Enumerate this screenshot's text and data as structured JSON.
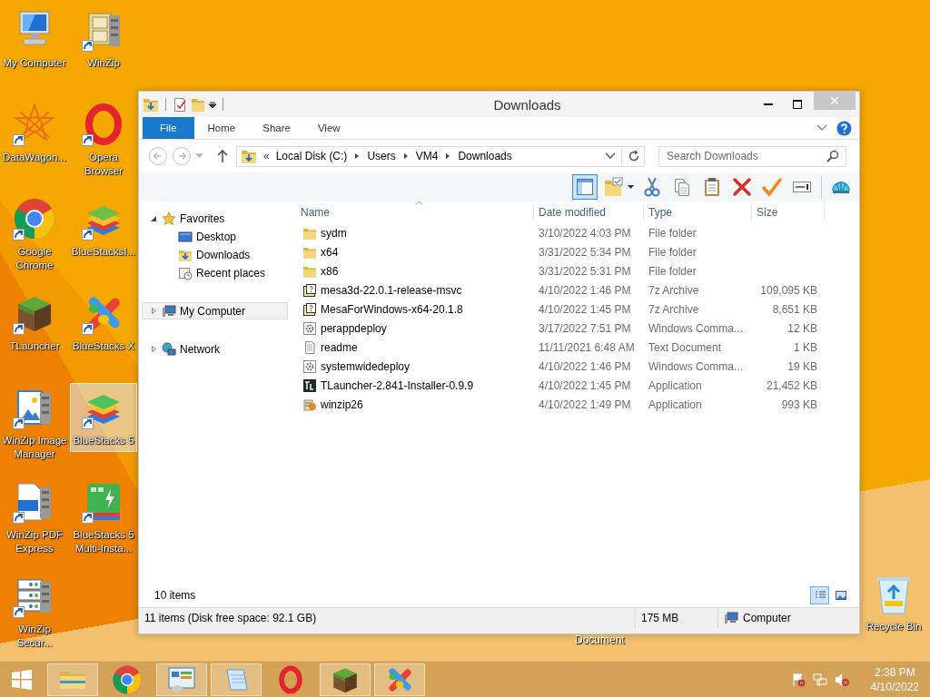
{
  "desktop": {
    "icons": [
      {
        "label": "My Computer",
        "shortcut": false,
        "selected": false
      },
      {
        "label": "WinZip",
        "shortcut": true,
        "selected": false
      },
      {
        "label": "DataWagon...",
        "shortcut": true,
        "selected": false
      },
      {
        "label": "Opera Browser",
        "shortcut": true,
        "selected": false
      },
      {
        "label": "Google Chrome",
        "shortcut": true,
        "selected": false
      },
      {
        "label": "BlueStacksI...",
        "shortcut": true,
        "selected": false
      },
      {
        "label": "TLauncher",
        "shortcut": true,
        "selected": false
      },
      {
        "label": "BlueStacks X",
        "shortcut": true,
        "selected": false
      },
      {
        "label": "WinZip Image Manager",
        "shortcut": true,
        "selected": false
      },
      {
        "label": "BlueStacks 5",
        "shortcut": true,
        "selected": true
      },
      {
        "label": "WinZip PDF Express",
        "shortcut": true,
        "selected": false
      },
      {
        "label": "BlueStacks 5 Multi-Insta...",
        "shortcut": true,
        "selected": false
      },
      {
        "label": "WinZip Secur...",
        "shortcut": true,
        "selected": false
      }
    ],
    "partial_icon": {
      "label": "Document"
    },
    "recycle_bin": {
      "label": "Recycle Bin"
    }
  },
  "window": {
    "title": "Downloads",
    "ribbon_tabs": [
      {
        "label": "File",
        "kind": "file",
        "selected": false
      },
      {
        "label": "Home",
        "kind": "tab",
        "selected": false
      },
      {
        "label": "Share",
        "kind": "tab",
        "selected": false
      },
      {
        "label": "View",
        "kind": "tab",
        "selected": false
      }
    ],
    "navigation": {
      "back_enabled": false,
      "forward_enabled": false
    },
    "address_bar": {
      "overflow": "«",
      "crumbs": [
        "Local Disk (C:)",
        "Users",
        "VM4",
        "Downloads"
      ]
    },
    "search": {
      "placeholder": "Search Downloads"
    },
    "toolbar": [
      {
        "kind": "pane",
        "selected": true
      },
      {
        "kind": "properties",
        "selected": false
      },
      {
        "kind": "cut",
        "selected": false
      },
      {
        "kind": "copy",
        "selected": false
      },
      {
        "kind": "paste",
        "selected": false
      },
      {
        "kind": "delete",
        "selected": false
      },
      {
        "kind": "check",
        "selected": false
      },
      {
        "kind": "rename",
        "selected": false
      },
      {
        "kind": "globe",
        "selected": false
      }
    ],
    "nav_pane": [
      {
        "label": "Favorites",
        "kind": "favorites",
        "expanded": true,
        "selected": false,
        "children": [
          {
            "label": "Desktop",
            "kind": "desktop",
            "selected": false
          },
          {
            "label": "Downloads",
            "kind": "downloads",
            "selected": false
          },
          {
            "label": "Recent places",
            "kind": "recent",
            "selected": false
          }
        ]
      },
      {
        "label": "My Computer",
        "kind": "computer",
        "expanded": false,
        "selected": true
      },
      {
        "label": "Network",
        "kind": "network",
        "expanded": false,
        "selected": false
      }
    ],
    "columns": [
      {
        "label": "Name",
        "sorted": true
      },
      {
        "label": "Date modified",
        "sorted": false
      },
      {
        "label": "Type",
        "sorted": false
      },
      {
        "label": "Size",
        "sorted": false
      }
    ],
    "files": [
      {
        "name": "sydm",
        "date": "3/10/2022 4:03 PM",
        "type": "File folder",
        "kind": "folder"
      },
      {
        "name": "x64",
        "date": "3/31/2022 5:34 PM",
        "type": "File folder",
        "kind": "folder"
      },
      {
        "name": "x86",
        "date": "3/31/2022 5:31 PM",
        "type": "File folder",
        "kind": "folder"
      },
      {
        "name": "mesa3d-22.0.1-release-msvc",
        "date": "4/10/2022 1:46 PM",
        "type": "7z Archive",
        "size": "109,095 KB",
        "kind": "archive"
      },
      {
        "name": "MesaForWindows-x64-20.1.8",
        "date": "4/10/2022 1:45 PM",
        "type": "7z Archive",
        "size": "8,651 KB",
        "kind": "archive"
      },
      {
        "name": "perappdeploy",
        "date": "3/17/2022 7:51 PM",
        "type": "Windows Comma...",
        "size": "12 KB",
        "kind": "script"
      },
      {
        "name": "readme",
        "date": "11/11/2021 6:48 AM",
        "type": "Text Document",
        "size": "1 KB",
        "kind": "text"
      },
      {
        "name": "systemwidedeploy",
        "date": "4/10/2022 1:46 PM",
        "type": "Windows Comma...",
        "size": "19 KB",
        "kind": "script"
      },
      {
        "name": "TLauncher-2.841-Installer-0.9.9",
        "date": "4/10/2022 1:45 PM",
        "type": "Application",
        "size": "21,452 KB",
        "kind": "app"
      },
      {
        "name": "winzip26",
        "date": "4/10/2022 1:49 PM",
        "type": "Application",
        "size": "993 KB",
        "kind": "installer"
      }
    ],
    "item_count": "10 items",
    "views": [
      {
        "kind": "details",
        "selected": true
      },
      {
        "kind": "large-icons",
        "selected": false
      }
    ],
    "status_bar": {
      "summary": "11 items (Disk free space: 92.1 GB)",
      "size": "175 MB",
      "location": "Computer"
    }
  },
  "taskbar": {
    "apps": [
      {
        "kind": "explorer",
        "running": true
      },
      {
        "kind": "chrome",
        "running": false
      },
      {
        "kind": "control",
        "running": true
      },
      {
        "kind": "notepad",
        "running": true
      },
      {
        "kind": "opera",
        "running": false
      },
      {
        "kind": "block",
        "running": true
      },
      {
        "kind": "xapp",
        "running": true
      }
    ],
    "clock": {
      "time": "2:38 PM",
      "date": "4/10/2022"
    }
  }
}
